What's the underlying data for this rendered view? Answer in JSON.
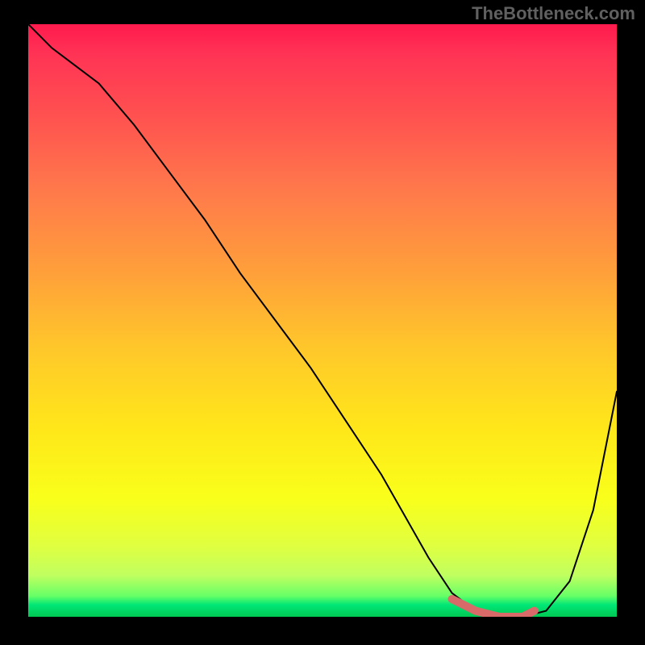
{
  "watermark": "TheBottleneck.com",
  "chart_data": {
    "type": "line",
    "title": "",
    "xlabel": "",
    "ylabel": "",
    "xlim": [
      0,
      100
    ],
    "ylim": [
      0,
      100
    ],
    "series": [
      {
        "name": "bottleneck-curve",
        "x": [
          0,
          4,
          8,
          12,
          18,
          24,
          30,
          36,
          42,
          48,
          54,
          60,
          64,
          68,
          72,
          76,
          80,
          84,
          88,
          92,
          96,
          100
        ],
        "y": [
          100,
          96,
          93,
          90,
          83,
          75,
          67,
          58,
          50,
          42,
          33,
          24,
          17,
          10,
          4,
          1,
          0,
          0,
          1,
          6,
          18,
          38
        ]
      },
      {
        "name": "optimal-band",
        "x": [
          72,
          76,
          80,
          84,
          86
        ],
        "y": [
          3,
          1,
          0,
          0,
          1
        ]
      }
    ],
    "gradient_stops": [
      {
        "pos": 0,
        "color": "#ff1a4d"
      },
      {
        "pos": 50,
        "color": "#ffc82a"
      },
      {
        "pos": 80,
        "color": "#f9ff1a"
      },
      {
        "pos": 100,
        "color": "#00c853"
      }
    ]
  }
}
